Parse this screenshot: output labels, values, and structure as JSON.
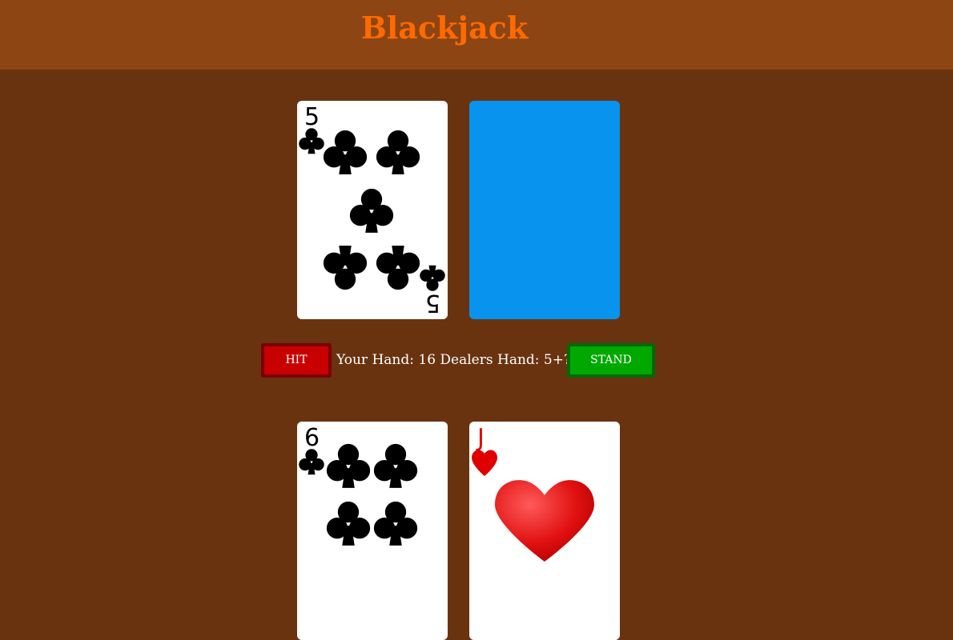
{
  "header": {
    "title": "Blackjack"
  },
  "dealer": {
    "cards": [
      {
        "rank": "5",
        "suit": "clubs",
        "suit_icon": "club-icon",
        "color": "#000000",
        "face_up": true
      },
      {
        "face_up": false,
        "back_color": "#0894ee"
      }
    ]
  },
  "controls": {
    "hit_label": "HIT",
    "stand_label": "STAND",
    "status_text": "Your Hand: 16 Dealers Hand: 5+?"
  },
  "player": {
    "cards": [
      {
        "rank": "6",
        "suit": "clubs",
        "suit_icon": "club-icon",
        "color": "#000000",
        "face_up": true
      },
      {
        "rank": "J",
        "suit": "hearts",
        "suit_icon": "heart-icon",
        "color": "#e00000",
        "face_up": true
      }
    ]
  },
  "colors": {
    "header_bg": "#8c4513",
    "table_bg": "#6a3310",
    "title": "#ff6a00",
    "hit_button": "#c80000",
    "stand_button": "#00a800"
  }
}
